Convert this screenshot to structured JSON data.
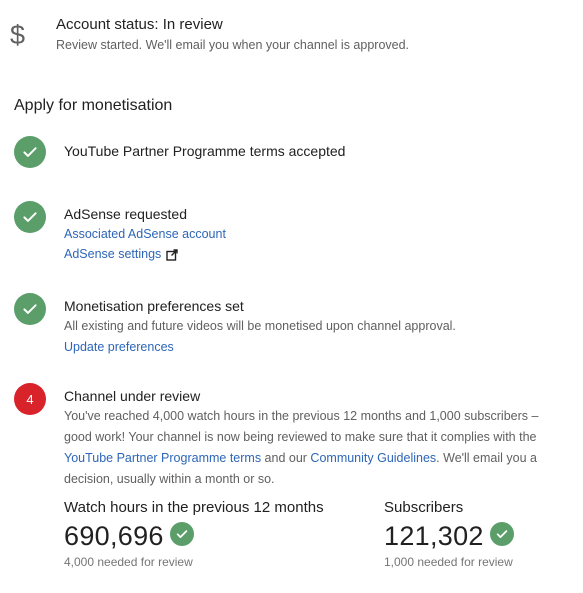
{
  "account_status": {
    "icon": "dollar-sign-icon",
    "title": "Account status: In review",
    "subtitle": "Review started. We'll email you when your channel is approved."
  },
  "section_title": "Apply for monetisation",
  "steps": [
    {
      "state": "complete",
      "title": "YouTube Partner Programme terms accepted"
    },
    {
      "state": "complete",
      "title": "AdSense requested",
      "links": [
        "Associated AdSense account",
        "AdSense settings"
      ]
    },
    {
      "state": "complete",
      "title": "Monetisation preferences set",
      "description": "All existing and future videos will be monetised upon channel approval.",
      "links": [
        "Update preferences"
      ]
    },
    {
      "state": "current",
      "number": "4",
      "title": "Channel under review",
      "description_parts": [
        "You've reached 4,000 watch hours in the previous 12 months and 1,000 subscribers – good work! Your channel is now being reviewed to make sure that it complies with the ",
        "YouTube Partner Programme terms",
        " and our ",
        "Community Guidelines",
        ". We'll email you a decision, usually within a month or so."
      ]
    }
  ],
  "stats": {
    "watch_hours": {
      "label": "Watch hours in the previous 12 months",
      "value": "690,696",
      "requirement": "4,000 needed for review"
    },
    "subscribers": {
      "label": "Subscribers",
      "value": "121,302",
      "requirement": "1,000 needed for review"
    }
  },
  "colors": {
    "success": "#5b9e6a",
    "alert": "#d8232a",
    "link": "#2d66b8",
    "secondary_text": "#606060"
  }
}
